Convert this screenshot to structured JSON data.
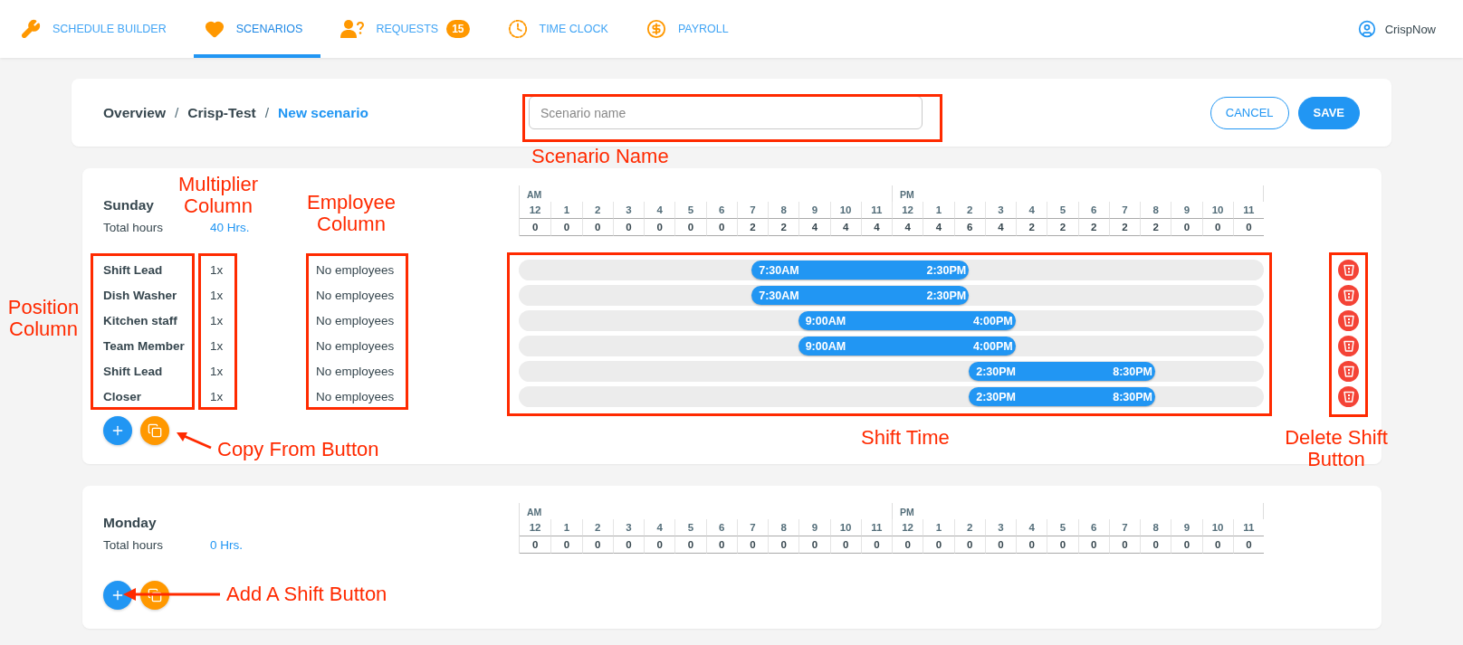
{
  "nav": {
    "tabs": [
      {
        "kind": "wrench",
        "label": "SCHEDULE BUILDER",
        "selected": false
      },
      {
        "kind": "heart",
        "label": "SCENARIOS",
        "selected": true
      },
      {
        "kind": "requests",
        "label": "REQUESTS",
        "badge": "15",
        "selected": false
      },
      {
        "kind": "clock",
        "label": "TIME CLOCK",
        "selected": false
      },
      {
        "kind": "dollar",
        "label": "PAYROLL",
        "selected": false
      }
    ],
    "user": "CrispNow"
  },
  "header": {
    "breadcrumb": [
      {
        "kind": "link",
        "label": "Overview"
      },
      {
        "kind": "separator",
        "label": "/"
      },
      {
        "kind": "link",
        "label": "Crisp-Test"
      },
      {
        "kind": "separator",
        "label": "/"
      },
      {
        "kind": "current",
        "label": "New scenario"
      }
    ],
    "scenario_name": {
      "placeholder": "Scenario name"
    },
    "buttons": [
      {
        "kind": "outline",
        "label": "CANCEL"
      },
      {
        "kind": "filled",
        "label": "SAVE"
      }
    ]
  },
  "days": [
    {
      "name": "Sunday",
      "total_label": "Total hours",
      "total_value": "40 Hrs.",
      "timeline": {
        "am": "AM",
        "pm": "PM",
        "hours": [
          "12",
          "1",
          "2",
          "3",
          "4",
          "5",
          "6",
          "7",
          "8",
          "9",
          "10",
          "11",
          "12",
          "1",
          "2",
          "3",
          "4",
          "5",
          "6",
          "7",
          "8",
          "9",
          "10",
          "11"
        ],
        "counts": [
          "0",
          "0",
          "0",
          "0",
          "0",
          "0",
          "0",
          "2",
          "2",
          "4",
          "4",
          "4",
          "4",
          "4",
          "6",
          "4",
          "2",
          "2",
          "2",
          "2",
          "2",
          "0",
          "0",
          "0"
        ]
      },
      "shifts": [
        {
          "position": "Shift Lead",
          "multiplier": "1x",
          "employees": "No employees",
          "start": "7:30AM",
          "end": "2:30PM"
        },
        {
          "position": "Dish Washer",
          "multiplier": "1x",
          "employees": "No employees",
          "start": "7:30AM",
          "end": "2:30PM"
        },
        {
          "position": "Kitchen staff",
          "multiplier": "1x",
          "employees": "No employees",
          "start": "9:00AM",
          "end": "4:00PM"
        },
        {
          "position": "Team Member",
          "multiplier": "1x",
          "employees": "No employees",
          "start": "9:00AM",
          "end": "4:00PM"
        },
        {
          "position": "Shift Lead",
          "multiplier": "1x",
          "employees": "No employees",
          "start": "2:30PM",
          "end": "8:30PM"
        },
        {
          "position": "Closer",
          "multiplier": "1x",
          "employees": "No employees",
          "start": "2:30PM",
          "end": "8:30PM"
        }
      ]
    },
    {
      "name": "Monday",
      "total_label": "Total hours",
      "total_value": "0 Hrs.",
      "timeline": {
        "am": "AM",
        "pm": "PM",
        "hours": [
          "12",
          "1",
          "2",
          "3",
          "4",
          "5",
          "6",
          "7",
          "8",
          "9",
          "10",
          "11",
          "12",
          "1",
          "2",
          "3",
          "4",
          "5",
          "6",
          "7",
          "8",
          "9",
          "10",
          "11"
        ],
        "counts": [
          "0",
          "0",
          "0",
          "0",
          "0",
          "0",
          "0",
          "0",
          "0",
          "0",
          "0",
          "0",
          "0",
          "0",
          "0",
          "0",
          "0",
          "0",
          "0",
          "0",
          "0",
          "0",
          "0",
          "0"
        ]
      }
    }
  ],
  "annotations": [
    {
      "text": "Scenario Name"
    },
    {
      "text": "Multiplier Column"
    },
    {
      "text": "Employee Column"
    },
    {
      "text": "Position Column"
    },
    {
      "text": "Copy From Button"
    },
    {
      "text": "Shift Time"
    },
    {
      "text": "Delete Shift Button"
    },
    {
      "text": "Add A Shift Button"
    }
  ]
}
